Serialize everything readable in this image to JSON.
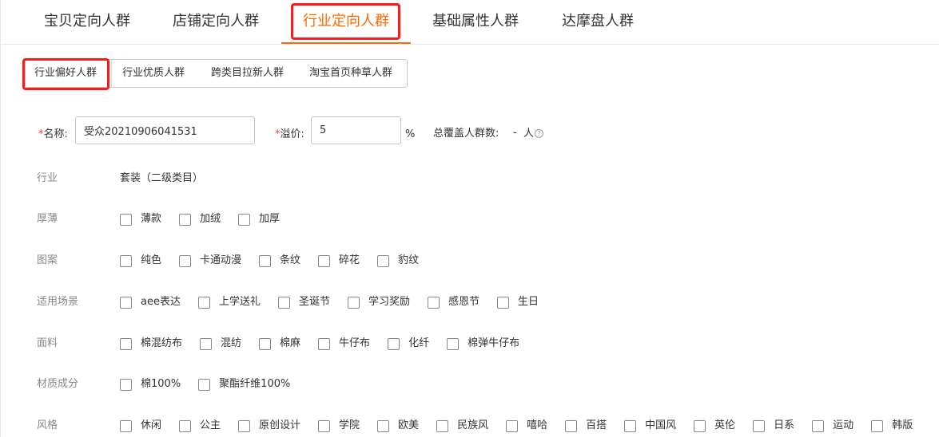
{
  "main_tabs": [
    {
      "label": "宝贝定向人群"
    },
    {
      "label": "店铺定向人群"
    },
    {
      "label": "行业定向人群",
      "active": true
    },
    {
      "label": "基础属性人群"
    },
    {
      "label": "达摩盘人群"
    }
  ],
  "sub_tabs": [
    {
      "label": "行业偏好人群",
      "active": true
    },
    {
      "label": "行业优质人群"
    },
    {
      "label": "跨类目拉新人群"
    },
    {
      "label": "淘宝首页种草人群"
    }
  ],
  "form": {
    "required_mark": "*",
    "name_label": "名称:",
    "name_value": "受众20210906041531",
    "premium_label": "溢价:",
    "premium_value": "5",
    "premium_unit": "%",
    "coverage_label": "总覆盖人群数:",
    "coverage_value": "-",
    "coverage_unit": "人",
    "help_icon": "?"
  },
  "attributes": {
    "industry_label": "行业",
    "industry_value": "套装（二级类目）",
    "rows": [
      {
        "label": "厚薄",
        "options": [
          "薄款",
          "加绒",
          "加厚"
        ]
      },
      {
        "label": "图案",
        "options": [
          "纯色",
          "卡通动漫",
          "条纹",
          "碎花",
          "豹纹"
        ]
      },
      {
        "label": "适用场景",
        "options": [
          "aee表达",
          "上学送礼",
          "圣诞节",
          "学习奖励",
          "感恩节",
          "生日"
        ]
      },
      {
        "label": "面料",
        "options": [
          "棉混纺布",
          "混纺",
          "棉麻",
          "牛仔布",
          "化纤",
          "棉弹牛仔布"
        ]
      },
      {
        "label": "材质成分",
        "options": [
          "棉100%",
          "聚酯纤维100%"
        ]
      },
      {
        "label": "风格",
        "options": [
          "休闲",
          "公主",
          "原创设计",
          "学院",
          "欧美",
          "民族风",
          "嘻哈",
          "百搭",
          "中国风",
          "英伦",
          "日系",
          "运动",
          "韩版"
        ]
      }
    ]
  },
  "colors": {
    "accent": "#ff6a00",
    "highlight_box": "#ff1a1a",
    "required": "#ff3b3b"
  }
}
